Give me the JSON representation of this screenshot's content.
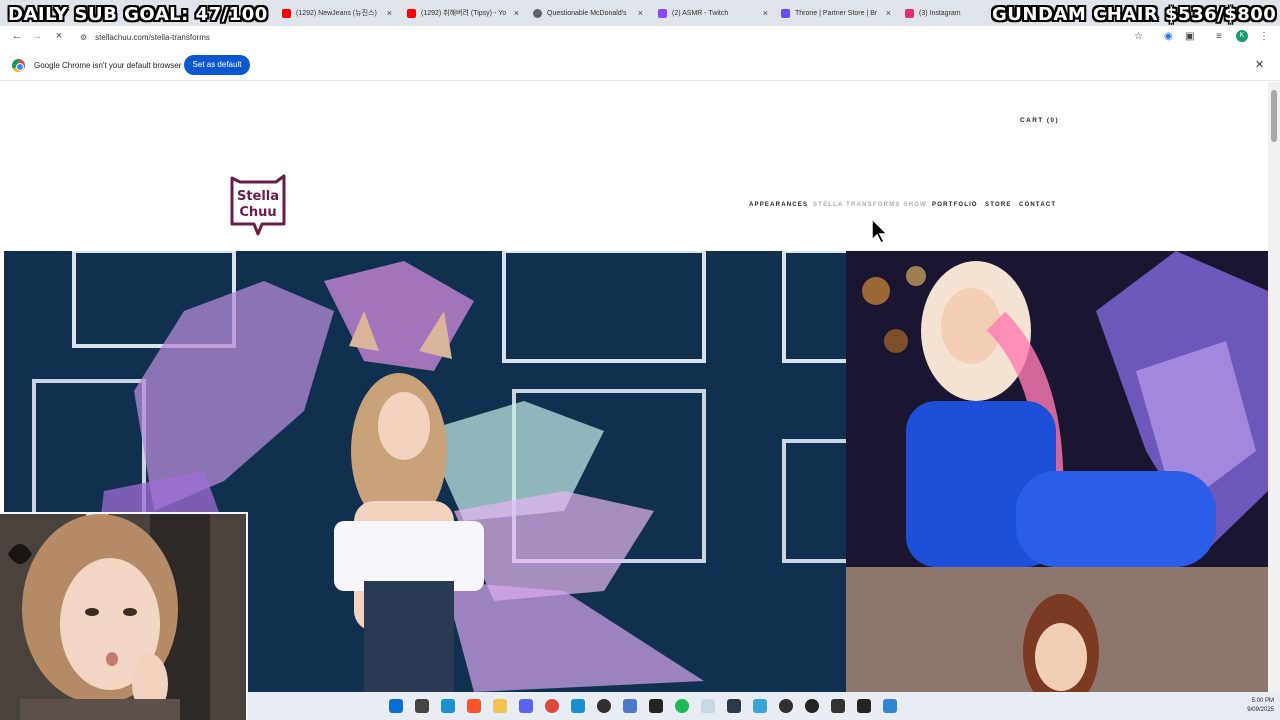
{
  "overlay": {
    "sub_goal": "DAILY SUB GOAL: 47/100",
    "chair_goal": "GUNDAM CHAIR $536/$800"
  },
  "tabs": [
    {
      "title": "(1292) NewJeans (뉴진스)",
      "icon": "youtube-icon",
      "color": "#ff0000"
    },
    {
      "title": "(1292) 취해버려 (Tipsy) - Yo",
      "icon": "youtube-icon",
      "color": "#ff0000"
    },
    {
      "title": "Questionable McDonald's",
      "icon": "globe-icon",
      "color": "#5f6368"
    },
    {
      "title": "(2) ASMR - Twitch",
      "icon": "twitch-icon",
      "color": "#9146ff"
    },
    {
      "title": "Throne | Partner Store | Br",
      "icon": "throne-icon",
      "color": "#6c4cf1"
    },
    {
      "title": "(3) Instagram",
      "icon": "instagram-icon",
      "color": "#e1306c"
    }
  ],
  "address_bar": {
    "url": "stellachuu.com/stella-transforms"
  },
  "infobar": {
    "message": "Google Chrome isn't your default browser",
    "button": "Set as default"
  },
  "site": {
    "cart": "CART (0)",
    "logo_text_1": "Stella",
    "logo_text_2": "Chuu",
    "nav": [
      {
        "label": "APPEARANCES",
        "active": false
      },
      {
        "label": "STELLA TRANSFORMS SHOW",
        "active": true
      },
      {
        "label": "PORTFOLIO",
        "active": false
      },
      {
        "label": "STORE",
        "active": false
      },
      {
        "label": "CONTACT",
        "active": false
      }
    ]
  },
  "taskbar": {
    "time": "5:00 PM",
    "date": "9/09/2025",
    "apps": [
      "windows-start-icon",
      "file-icon",
      "edge-icon",
      "brave-icon",
      "explorer-icon",
      "discord-icon",
      "chrome-icon",
      "edge-icon",
      "obs-icon",
      "shield-icon",
      "terminal-icon",
      "spotify-icon",
      "steam-icon",
      "capture-icon",
      "notes-icon",
      "obs-icon",
      "record-icon",
      "download-icon",
      "terminal-icon",
      "photos-icon"
    ]
  },
  "colors": {
    "accent": "#0b57d0",
    "logo": "#6b1d4a"
  }
}
